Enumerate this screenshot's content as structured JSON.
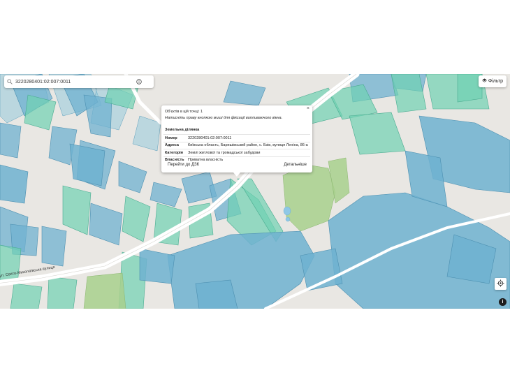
{
  "search": {
    "value": "3220280401:02:007:0011"
  },
  "filter": {
    "label": "Фільтр",
    "icon": "layers-icon"
  },
  "popup": {
    "count_text": "Об'єктів в цій точці: 1",
    "hint_text": "Натисніть праву кнопкою миші для фіксації випливаючого вікна.",
    "section_title": "Земельна ділянка",
    "rows": [
      {
        "key": "Номер",
        "value": "3220280401:02:007:0011"
      },
      {
        "key": "Адреса",
        "value": "Київська область, Баришівський район, с. Бзів, вулиця Леніна, 86-а"
      },
      {
        "key": "Категорія",
        "value": "Землі житлової та громадської забудови"
      },
      {
        "key": "Власність",
        "value": "Приватна власність"
      }
    ],
    "goto_label": "Перейти до ДЗК",
    "details_label": "Детальніше",
    "close_label": "×"
  },
  "map": {
    "street_label": "вул. Свято-Миколаївська вулиця",
    "colors": {
      "background": "#e9e7e3",
      "parcel_blue": "#6fb2d0",
      "parcel_teal": "#6fd1b2",
      "green_area": "#a8d08d",
      "road": "#ffffff"
    }
  },
  "controls": {
    "locate_icon": "crosshair-icon",
    "info_label": "i"
  }
}
